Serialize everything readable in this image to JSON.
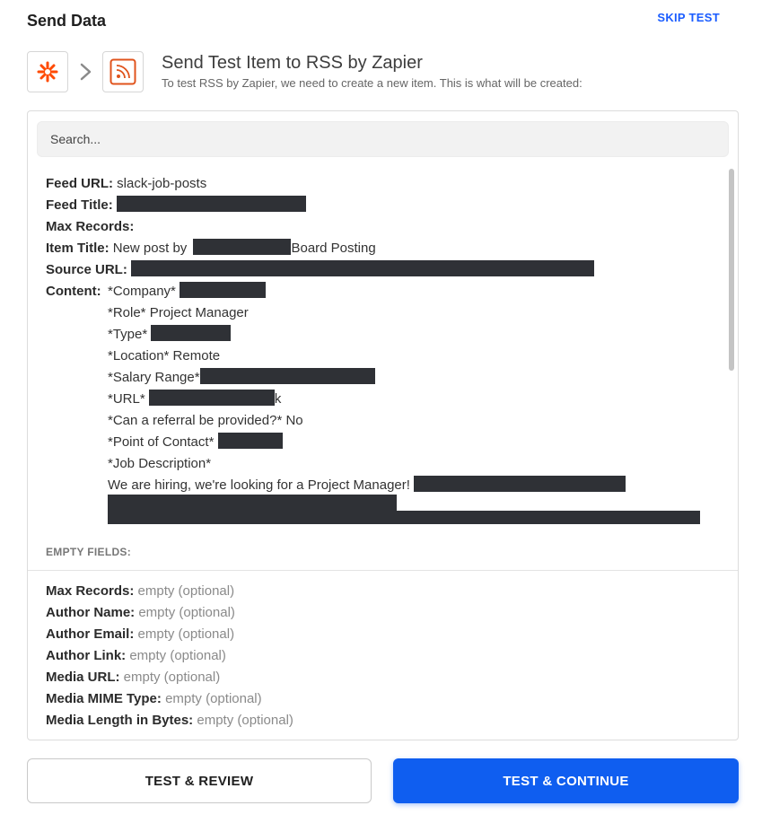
{
  "header": {
    "title": "Send Data",
    "skip_label": "SKIP TEST"
  },
  "step": {
    "source_app_icon": "zapier-asterisk-icon",
    "target_app_icon": "rss-feed-icon",
    "title": "Send Test Item to RSS by Zapier",
    "subtitle": "To test RSS by Zapier, we need to create a new item. This is what will be created:"
  },
  "search": {
    "placeholder": "Search..."
  },
  "fields": {
    "feed_url": {
      "label": "Feed URL:",
      "value": "slack-job-posts"
    },
    "feed_title": {
      "label": "Feed Title:"
    },
    "max_records": {
      "label": "Max Records:"
    },
    "item_title": {
      "label": "Item Title:",
      "prefix": "New post by",
      "suffix": "Board Posting"
    },
    "source_url": {
      "label": "Source URL:"
    },
    "content": {
      "label": "Content:",
      "lines": {
        "company": "*Company*",
        "role": "*Role* Project Manager",
        "type": "*Type*",
        "location": "*Location* Remote",
        "salary": "*Salary Range*",
        "url": "*URL*",
        "url_tail": "k",
        "referral": "*Can a referral be provided?* No",
        "contact": "*Point of Contact*",
        "description": "*Job Description*",
        "hiring": "We are hiring, we're looking for a Project Manager!"
      }
    }
  },
  "empty_fields": {
    "header": "EMPTY FIELDS:",
    "items": [
      {
        "label": "Max Records:",
        "value": "empty (optional)"
      },
      {
        "label": "Author Name:",
        "value": "empty (optional)"
      },
      {
        "label": "Author Email:",
        "value": "empty (optional)"
      },
      {
        "label": "Author Link:",
        "value": "empty (optional)"
      },
      {
        "label": "Media URL:",
        "value": "empty (optional)"
      },
      {
        "label": "Media MIME Type:",
        "value": "empty (optional)"
      },
      {
        "label": "Media Length in Bytes:",
        "value": "empty (optional)"
      }
    ]
  },
  "actions": {
    "review_label": "TEST & REVIEW",
    "continue_label": "TEST & CONTINUE"
  },
  "colors": {
    "accent": "#0f5ef0",
    "link": "#1a5cff",
    "zapier_orange": "#ff4a00",
    "redaction": "#2f3136"
  }
}
